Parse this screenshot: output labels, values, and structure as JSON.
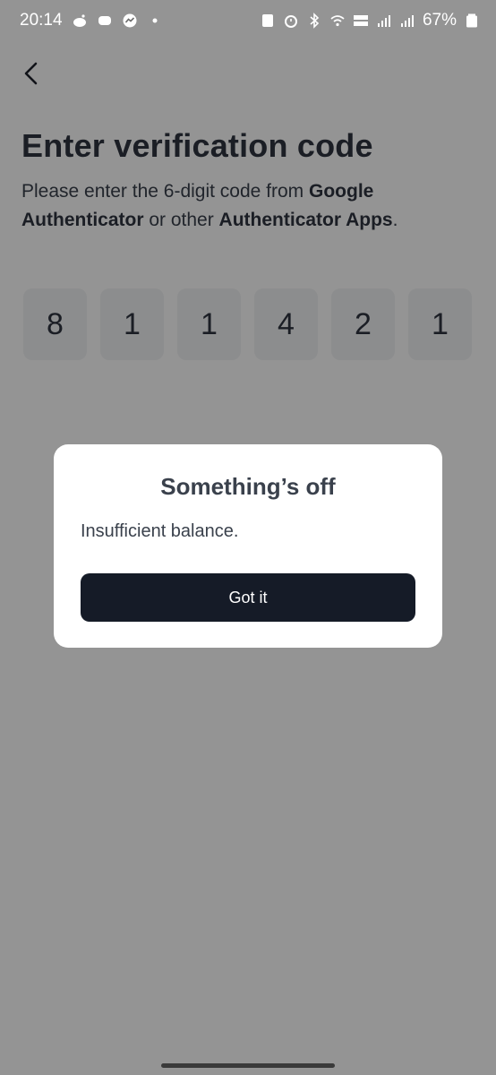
{
  "status_bar": {
    "time": "20:14",
    "battery": "67%",
    "left_icons": [
      "reddit-icon",
      "discord-icon",
      "messenger-icon",
      "dot-icon"
    ],
    "right_icons": [
      "nfc-icon",
      "alarm-icon",
      "bluetooth-icon",
      "wifi-icon",
      "volte-icon",
      "signal-icon",
      "signal-icon",
      "battery-icon"
    ]
  },
  "page": {
    "title": "Enter verification code",
    "instruction_part1": "Please enter the 6-digit code from ",
    "instruction_bold1": "Google Authenticator",
    "instruction_part2": " or other ",
    "instruction_bold2": "Authenticator Apps",
    "instruction_part3": ".",
    "code_digits": [
      "8",
      "1",
      "1",
      "4",
      "2",
      "1"
    ]
  },
  "dialog": {
    "title": "Something’s off",
    "message": "Insufficient balance.",
    "button_label": "Got it"
  },
  "colors": {
    "overlay": "#6b6b6b",
    "button_bg": "#151b27",
    "text": "#3a414c"
  }
}
